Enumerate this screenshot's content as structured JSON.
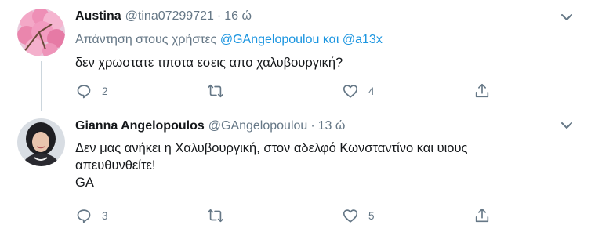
{
  "tweets": [
    {
      "display_name": "Austina",
      "handle": "@tina07299721",
      "separator": "·",
      "time": "16 ώ",
      "reply_prefix": "Απάντηση στους χρήστες ",
      "reply_mention_1": "@GAngelopoulou",
      "reply_joiner": " και ",
      "reply_mention_2": "@a13x___",
      "text": "δεν χρωστατε τιποτα εσεις απο χαλυβουργική?",
      "replies": "2",
      "retweets": "",
      "likes": "4"
    },
    {
      "display_name": "Gianna Angelopoulos",
      "handle": "@GAngelopoulou",
      "separator": "·",
      "time": "13 ώ",
      "text_line_1": "Δεν μας ανήκει η Χαλυβουργική, στον αδελφό Κωνσταντίνο και υιους",
      "text_line_2": "απευθυνθείτε!",
      "text_line_3": "GA",
      "replies": "3",
      "retweets": "",
      "likes": "5"
    }
  ],
  "colors": {
    "text_primary": "#14171a",
    "text_secondary": "#657786",
    "link": "#1b95e0",
    "divider": "#e6ecf0",
    "thread_line": "#ccd6dd"
  },
  "icons": [
    "chevron-down-icon",
    "reply-icon",
    "retweet-icon",
    "like-icon",
    "share-icon"
  ]
}
